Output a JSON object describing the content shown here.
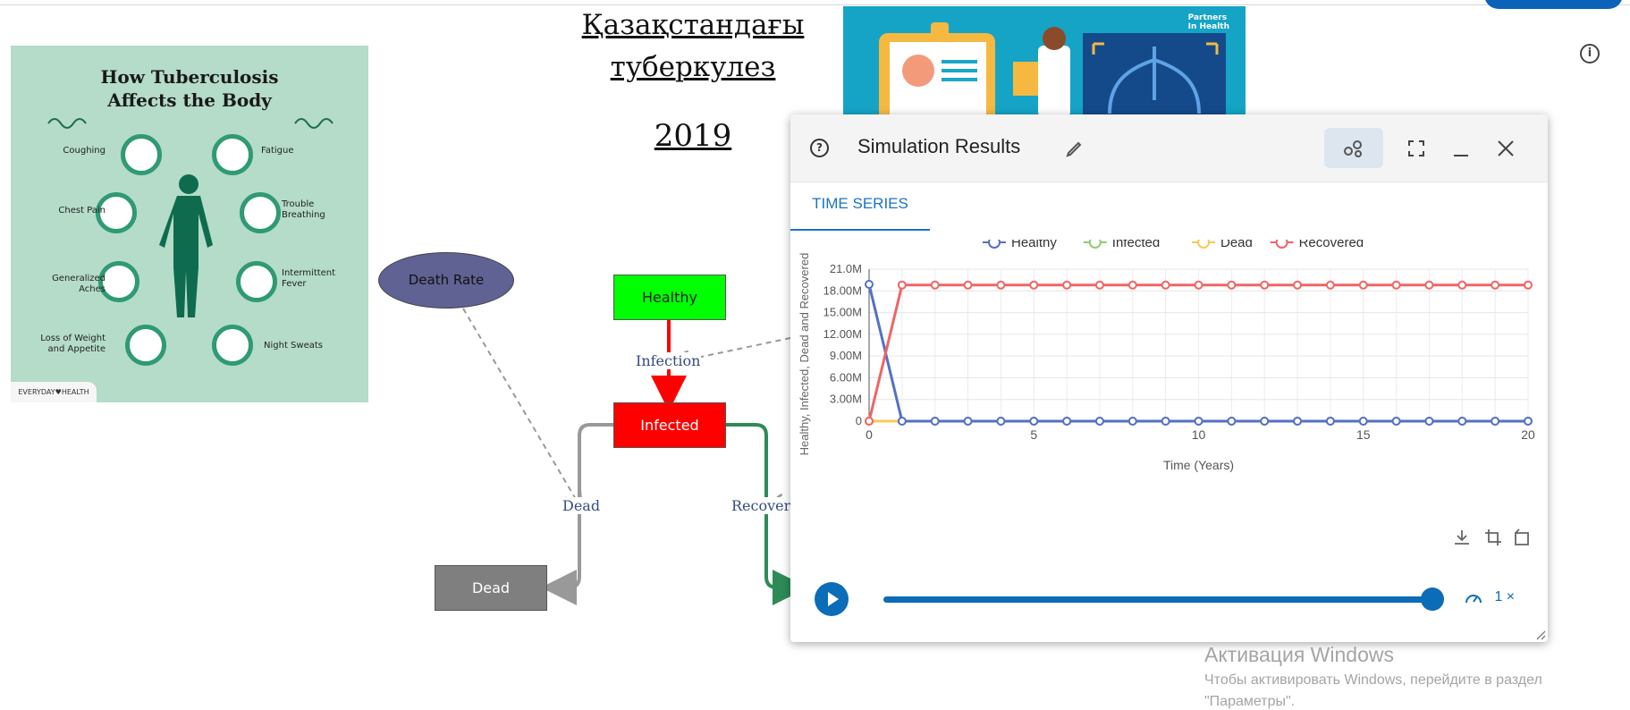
{
  "canvas": {
    "title_line1": "Қазақстандағы",
    "title_line2": "туберкулез",
    "title_year": "2019"
  },
  "infographic": {
    "title_line1": "How Tuberculosis",
    "title_line2": "Affects the Body",
    "symptoms_left": [
      [
        "Coughing"
      ],
      [
        "Chest Pain"
      ],
      [
        "Generalized",
        "Aches"
      ],
      [
        "Loss of Weight",
        "and Appetite"
      ]
    ],
    "symptoms_right": [
      [
        "Fatigue"
      ],
      [
        "Trouble",
        "Breathing"
      ],
      [
        "Intermittent",
        "Fever"
      ],
      [
        "Night Sweats"
      ]
    ],
    "brand": "EVERYDAY♥HEALTH"
  },
  "poster": {
    "brand_line1": "Partners",
    "brand_line2": "In Health"
  },
  "diagram": {
    "nodes": {
      "death_rate": "Death Rate",
      "healthy": "Healthy",
      "infected": "Infected",
      "dead": "Dead"
    },
    "edges": {
      "infection": "Infection",
      "dead": "Dead",
      "recovery": "Recover"
    },
    "colors": {
      "healthy": "#00ff00",
      "infected": "#ff0000",
      "dead": "#7f7f7f",
      "death_rate": "#5f6293",
      "infection_arrow": "#ff0000",
      "recovery_arrow": "#2e8b57"
    }
  },
  "window": {
    "help_icon": "②",
    "title": "Simulation Results",
    "tab": "TIME SERIES",
    "playback_speed": "1 ×",
    "playback_progress": 1.0
  },
  "chart_data": {
    "type": "line",
    "xlabel": "Time (Years)",
    "ylabel": "Healthy, Infected, Dead and Recovered",
    "xlim": [
      0,
      20
    ],
    "ylim": [
      0,
      21000000
    ],
    "x_ticks": [
      0,
      5,
      10,
      15,
      20
    ],
    "y_ticks": [
      0,
      3000000,
      6000000,
      9000000,
      12000000,
      15000000,
      18000000,
      21000000
    ],
    "y_tick_labels": [
      "0",
      "3.00M",
      "6.00M",
      "9.00M",
      "12.00M",
      "15.00M",
      "18.00M",
      "21.0M"
    ],
    "grid": true,
    "legend_position": "top",
    "x": [
      0,
      1,
      2,
      3,
      4,
      5,
      6,
      7,
      8,
      9,
      10,
      11,
      12,
      13,
      14,
      15,
      16,
      17,
      18,
      19,
      20
    ],
    "series": [
      {
        "name": "Healthy",
        "color": "#5470c6",
        "values": [
          18900000,
          0,
          0,
          0,
          0,
          0,
          0,
          0,
          0,
          0,
          0,
          0,
          0,
          0,
          0,
          0,
          0,
          0,
          0,
          0,
          0
        ]
      },
      {
        "name": "Infected",
        "color": "#91cc75",
        "values": [
          0,
          0,
          0,
          0,
          0,
          0,
          0,
          0,
          0,
          0,
          0,
          0,
          0,
          0,
          0,
          0,
          0,
          0,
          0,
          0,
          0
        ]
      },
      {
        "name": "Dead",
        "color": "#fac858",
        "values": [
          0,
          0,
          0,
          0,
          0,
          0,
          0,
          0,
          0,
          0,
          0,
          0,
          0,
          0,
          0,
          0,
          0,
          0,
          0,
          0,
          0
        ]
      },
      {
        "name": "Recovered",
        "color": "#ee6666",
        "values": [
          0,
          18800000,
          18800000,
          18800000,
          18800000,
          18800000,
          18800000,
          18800000,
          18800000,
          18800000,
          18800000,
          18800000,
          18800000,
          18800000,
          18800000,
          18800000,
          18800000,
          18800000,
          18800000,
          18800000,
          18800000
        ]
      }
    ]
  },
  "watermark": {
    "line1": "Активация Windows",
    "line2": "Чтобы активировать Windows, перейдите в раздел",
    "line3": "\"Параметры\"."
  }
}
